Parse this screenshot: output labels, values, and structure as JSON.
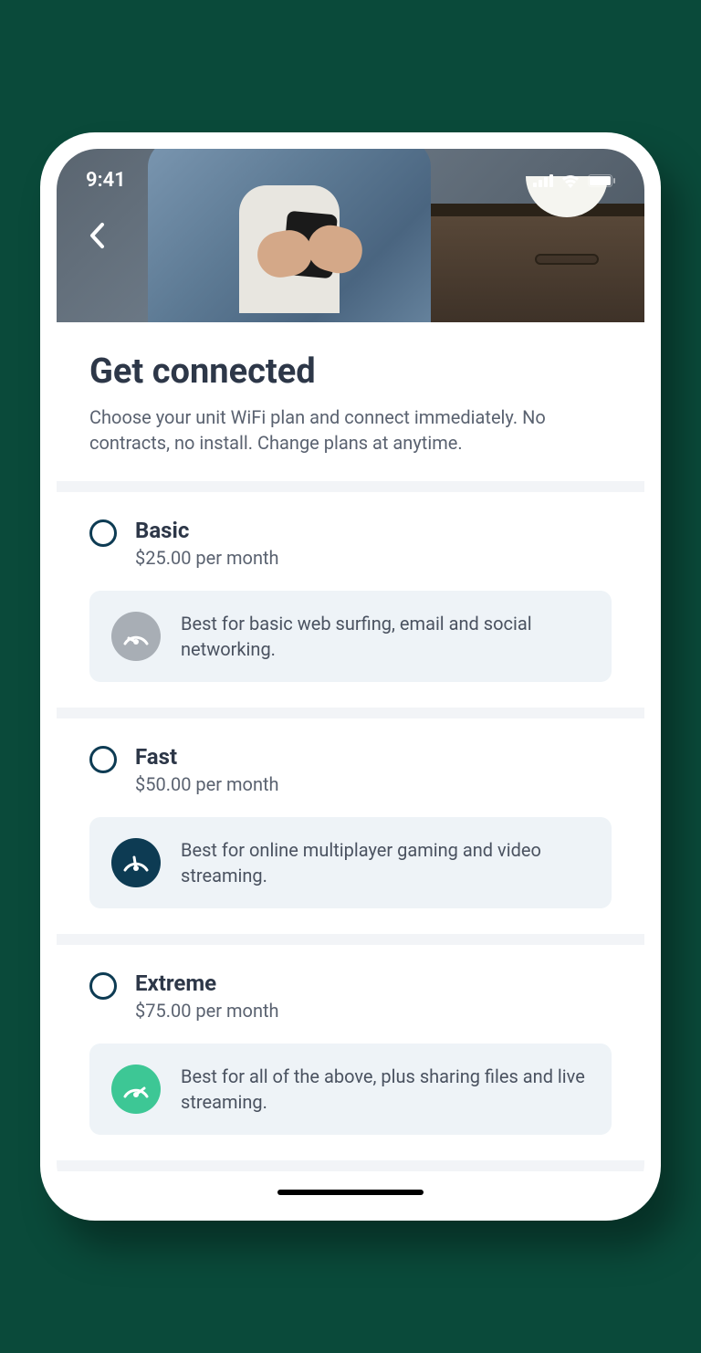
{
  "status": {
    "time": "9:41"
  },
  "header": {
    "title": "Get connected",
    "subtitle": "Choose your unit WiFi plan and connect immediately. No contracts, no install. Change plans at anytime."
  },
  "plans": [
    {
      "name": "Basic",
      "price": "$25.00 per month",
      "description": "Best for basic web surfing, email and social networking.",
      "iconColor": "gray"
    },
    {
      "name": "Fast",
      "price": "$50.00 per month",
      "description": "Best for online multiplayer gaming and video streaming.",
      "iconColor": "navy"
    },
    {
      "name": "Extreme",
      "price": "$75.00 per month",
      "description": "Best for all of the above, plus sharing files and live streaming.",
      "iconColor": "green"
    }
  ]
}
